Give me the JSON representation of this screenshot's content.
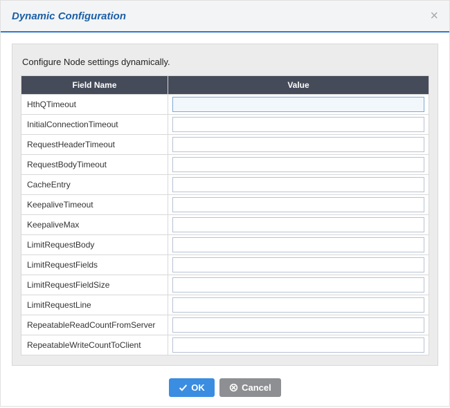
{
  "header": {
    "title": "Dynamic Configuration"
  },
  "body": {
    "instruction": "Configure Node settings dynamically.",
    "columns": {
      "field": "Field Name",
      "value": "Value"
    },
    "rows": [
      {
        "name": "HthQTimeout",
        "value": "",
        "focused": true
      },
      {
        "name": "InitialConnectionTimeout",
        "value": ""
      },
      {
        "name": "RequestHeaderTimeout",
        "value": ""
      },
      {
        "name": "RequestBodyTimeout",
        "value": ""
      },
      {
        "name": "CacheEntry",
        "value": ""
      },
      {
        "name": "KeepaliveTimeout",
        "value": ""
      },
      {
        "name": "KeepaliveMax",
        "value": ""
      },
      {
        "name": "LimitRequestBody",
        "value": ""
      },
      {
        "name": "LimitRequestFields",
        "value": ""
      },
      {
        "name": "LimitRequestFieldSize",
        "value": ""
      },
      {
        "name": "LimitRequestLine",
        "value": ""
      },
      {
        "name": "RepeatableReadCountFromServer",
        "value": ""
      },
      {
        "name": "RepeatableWriteCountToClient",
        "value": ""
      }
    ]
  },
  "footer": {
    "ok": "OK",
    "cancel": "Cancel"
  }
}
